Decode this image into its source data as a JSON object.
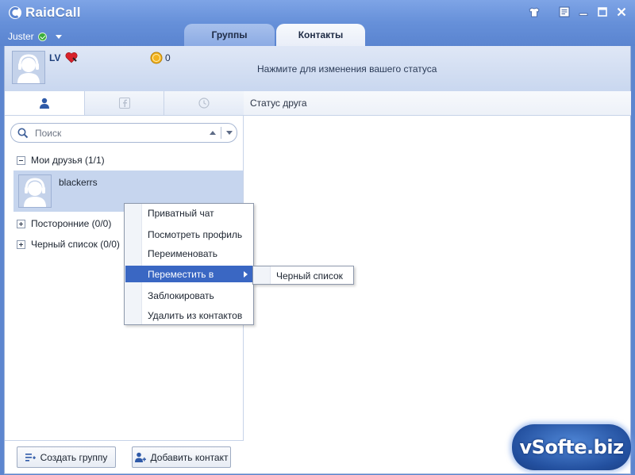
{
  "app": {
    "title": "RaidCall"
  },
  "user": {
    "name": "Juster",
    "nick": "LV",
    "coins": "0",
    "status_prompt": "Нажмите для изменения вашего статуса"
  },
  "top_tabs": [
    {
      "label": "Группы",
      "active": false
    },
    {
      "label": "Контакты",
      "active": true
    }
  ],
  "window_controls": [
    "skin-icon",
    "settings-icon",
    "minimize-icon",
    "maximize-icon",
    "close-icon"
  ],
  "left_tabs": [
    {
      "icon": "person-icon",
      "active": true
    },
    {
      "icon": "facebook-icon",
      "active": false
    },
    {
      "icon": "clock-icon",
      "active": false
    }
  ],
  "search": {
    "placeholder": "Поиск"
  },
  "groups": [
    {
      "label": "Мои друзья (1/1)",
      "expanded": true,
      "contacts": [
        {
          "name": "blackerrs"
        }
      ]
    },
    {
      "label": "Посторонние (0/0)",
      "expanded": false
    },
    {
      "label": "Черный список (0/0)",
      "expanded": false
    }
  ],
  "right_header": {
    "label": "Статус друга"
  },
  "context_menu": {
    "items": [
      {
        "label": "Приватный чат"
      },
      {
        "label": "Посмотреть профиль"
      },
      {
        "label": "Переименовать"
      },
      {
        "label": "Переместить в",
        "highlighted": true,
        "has_submenu": true
      },
      {
        "label": "Заблокировать"
      },
      {
        "label": "Удалить из контактов"
      }
    ],
    "submenu": {
      "items": [
        {
          "label": "Черный список"
        }
      ]
    }
  },
  "buttons": {
    "create_group": "Создать группу",
    "add_contact": "Добавить контакт"
  },
  "watermark": "vSofte.biz",
  "colors": {
    "titlebar": "#6690d9",
    "highlight": "#3a67c3",
    "status_online": "#3aae3a",
    "selected_row": "#c6d5ee"
  }
}
